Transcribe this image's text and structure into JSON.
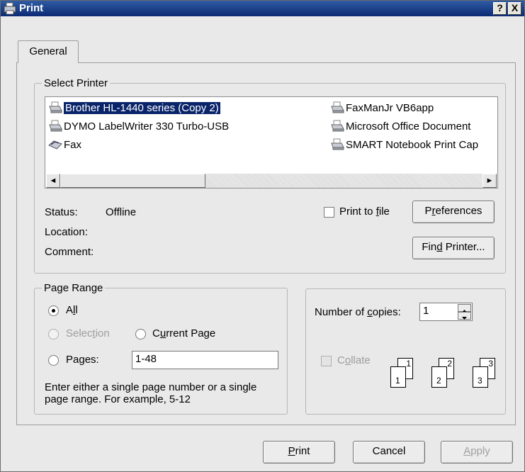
{
  "window": {
    "title": "Print",
    "help_label": "?",
    "close_label": "X"
  },
  "tabs": [
    {
      "label": "General"
    }
  ],
  "select_printer": {
    "legend": "Select Printer",
    "printers": [
      {
        "name": "Brother HL-1440 series (Copy 2)",
        "icon": "printer-icon",
        "selected": true
      },
      {
        "name": "DYMO LabelWriter 330 Turbo-USB",
        "icon": "printer-icon"
      },
      {
        "name": "Fax",
        "icon": "fax-icon"
      },
      {
        "name": "FaxManJr VB6app",
        "icon": "printer-icon"
      },
      {
        "name": "Microsoft Office Document",
        "icon": "printer-icon"
      },
      {
        "name": "SMART Notebook Print Cap",
        "icon": "printer-icon"
      }
    ],
    "scroll_left": "◄",
    "scroll_right": "►",
    "status_label": "Status:",
    "status_value": "Offline",
    "location_label": "Location:",
    "location_value": "",
    "comment_label": "Comment:",
    "comment_value": "",
    "print_to_file": {
      "pre": "Print to ",
      "ul": "f",
      "post": "ile",
      "checked": false
    },
    "preferences": {
      "pre": "P",
      "ul": "r",
      "post": "eferences"
    },
    "find_printer": {
      "pre": "Fin",
      "ul": "d",
      "post": " Printer..."
    }
  },
  "page_range": {
    "legend": "Page Range",
    "all": {
      "pre": "A",
      "ul": "l",
      "post": "l",
      "checked": true
    },
    "selection": {
      "pre": "Selec",
      "ul": "t",
      "post": "ion",
      "enabled": false
    },
    "current_page": {
      "pre": "C",
      "ul": "u",
      "post": "rrent Page"
    },
    "pages": {
      "pre": "Pa",
      "ul": "g",
      "post": "es:"
    },
    "pages_value": "1-48",
    "hint_line1": "Enter either a single page number or a single",
    "hint_line2": "page range.  For example, 5-12"
  },
  "copies": {
    "label_pre": "Number of ",
    "label_ul": "c",
    "label_post": "opies:",
    "value": "1",
    "collate": {
      "pre": "C",
      "ul": "o",
      "post": "llate",
      "checked": false,
      "enabled": false
    },
    "collate_pages": [
      "1",
      "1",
      "2",
      "2",
      "3",
      "3"
    ]
  },
  "buttons": {
    "print": {
      "pre": "",
      "ul": "P",
      "post": "rint"
    },
    "cancel": "Cancel",
    "apply": {
      "pre": "",
      "ul": "A",
      "post": "pply",
      "enabled": false
    }
  },
  "colors": {
    "title_bar": "#0b2b74",
    "selection": "#0a246a",
    "dialog_bg": "#e9e9e9"
  }
}
